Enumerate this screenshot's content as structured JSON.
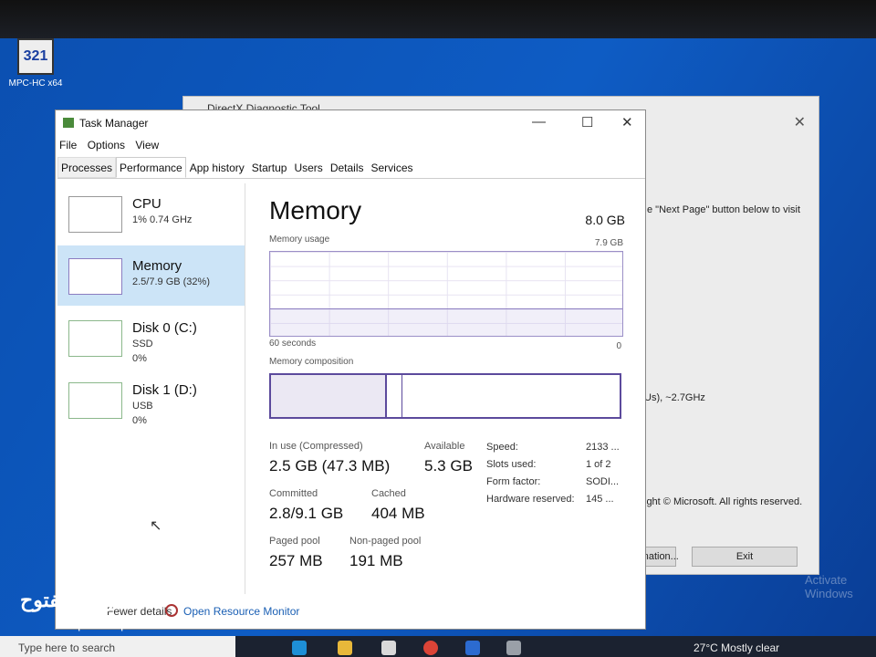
{
  "desktop": {
    "icon_label": "MPC-HC x64",
    "icon_text": "321",
    "activate": "Activate Windows"
  },
  "directx": {
    "title": "DirectX Diagnostic Tool",
    "line1": "e \"Next Page\" button below to visit",
    "line2": "Us), ~2.7GHz",
    "line3": "ight © Microsoft. All rights reserved.",
    "btn_info": "rmation...",
    "btn_exit": "Exit"
  },
  "taskmanager": {
    "title": "Task Manager",
    "menu": [
      "File",
      "Options",
      "View"
    ],
    "tabs": [
      "Processes",
      "Performance",
      "App history",
      "Startup",
      "Users",
      "Details",
      "Services"
    ],
    "active_tab": "Performance",
    "sidebar": [
      {
        "name": "CPU",
        "line1": "1% 0.74 GHz",
        "line2": ""
      },
      {
        "name": "Memory",
        "line1": "2.5/7.9 GB (32%)",
        "line2": ""
      },
      {
        "name": "Disk 0 (C:)",
        "line1": "SSD",
        "line2": "0%"
      },
      {
        "name": "Disk 1 (D:)",
        "line1": "USB",
        "line2": "0%"
      }
    ],
    "memory": {
      "title": "Memory",
      "total": "8.0 GB",
      "usage_label": "Memory usage",
      "usage_max": "7.9 GB",
      "time_left": "60 seconds",
      "time_right": "0",
      "composition_label": "Memory composition",
      "in_use_label": "In use (Compressed)",
      "in_use": "2.5 GB (47.3 MB)",
      "available_label": "Available",
      "available": "5.3 GB",
      "committed_label": "Committed",
      "committed": "2.8/9.1 GB",
      "cached_label": "Cached",
      "cached": "404 MB",
      "paged_label": "Paged pool",
      "paged": "257 MB",
      "nonpaged_label": "Non-paged pool",
      "nonpaged": "191 MB",
      "specs": [
        [
          "Speed:",
          "2133 ..."
        ],
        [
          "Slots used:",
          "1 of 2"
        ],
        [
          "Form factor:",
          "SODI..."
        ],
        [
          "Hardware reserved:",
          "145 ..."
        ]
      ]
    },
    "fewer_details": "Fewer details",
    "resource_monitor": "Open Resource Monitor"
  },
  "taskbar": {
    "search_placeholder": "Type here to search",
    "weather": "27°C  Mostly clear"
  },
  "watermark": {
    "arabic": "السوق المفتوح",
    "latin": "opensooq.com"
  }
}
